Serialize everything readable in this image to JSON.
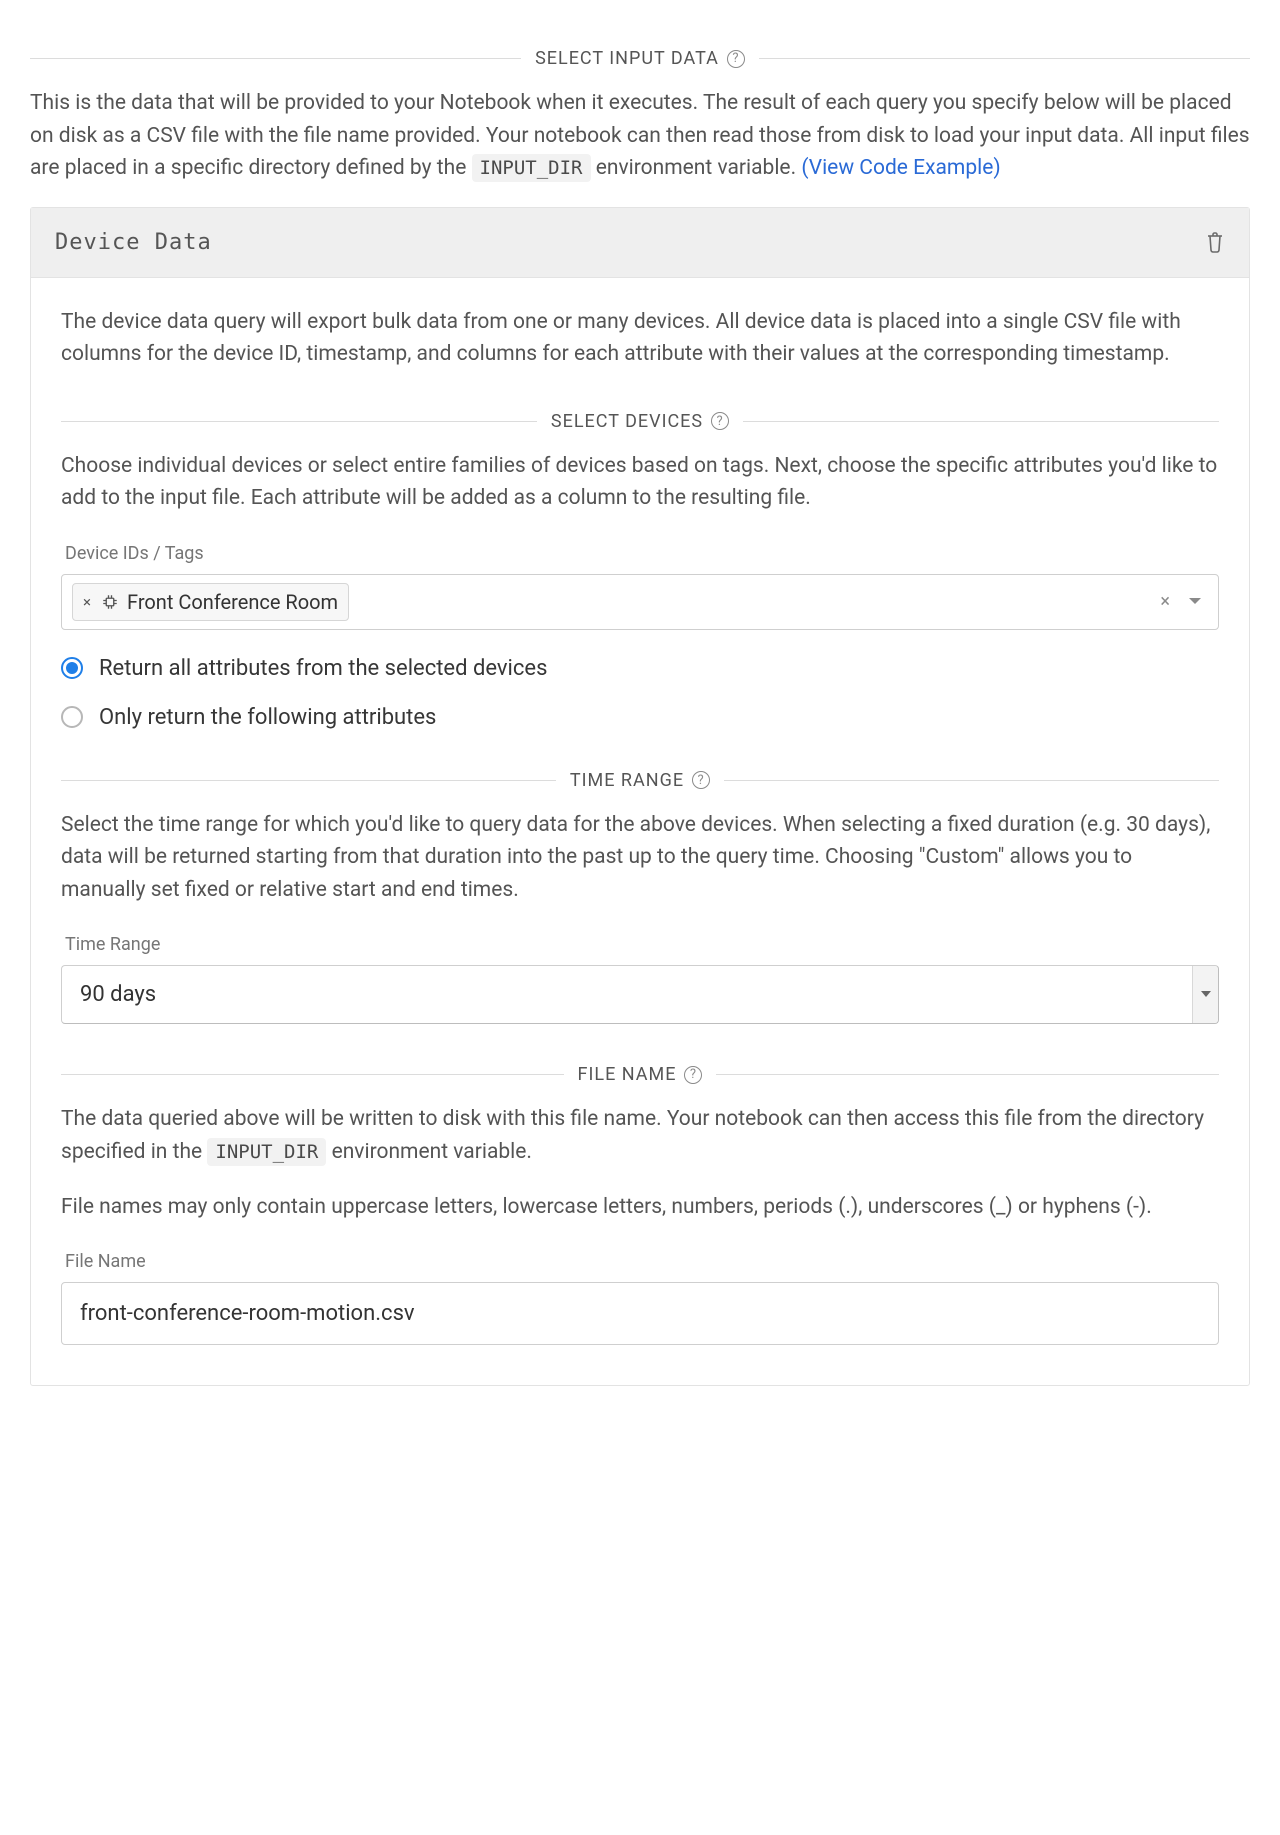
{
  "header": {
    "title": "SELECT INPUT DATA",
    "description_pre": "This is the data that will be provided to your Notebook when it executes. The result of each query you specify below will be placed on disk as a CSV file with the file name provided. Your notebook can then read those from disk to load your input data. All input files are placed in a specific directory defined by the ",
    "input_dir_code": "INPUT_DIR",
    "description_post": " environment variable. ",
    "view_example_link": "(View Code Example)"
  },
  "panel": {
    "title": "Device Data",
    "description": "The device data query will export bulk data from one or many devices. All device data is placed into a single CSV file with columns for the device ID, timestamp, and columns for each attribute with their values at the corresponding timestamp."
  },
  "devices": {
    "title": "SELECT DEVICES",
    "description": "Choose individual devices or select entire families of devices based on tags. Next, choose the specific attributes you'd like to add to the input file. Each attribute will be added as a column to the resulting file.",
    "field_label": "Device IDs / Tags",
    "selected_tag_name": "Front Conference Room",
    "radio_all": "Return all attributes from the selected devices",
    "radio_only": "Only return the following attributes",
    "radio_selected": "all"
  },
  "time_range": {
    "title": "TIME RANGE",
    "description": "Select the time range for which you'd like to query data for the above devices. When selecting a fixed duration (e.g. 30 days), data will be returned starting from that duration into the past up to the query time. Choosing \"Custom\" allows you to manually set fixed or relative start and end times.",
    "field_label": "Time Range",
    "value": "90 days"
  },
  "file_name": {
    "title": "FILE NAME",
    "description_pre": "The data queried above will be written to disk with this file name. Your notebook can then access this file from the directory specified in the ",
    "input_dir_code": "INPUT_DIR",
    "description_post": " environment variable.",
    "description2": "File names may only contain uppercase letters, lowercase letters, numbers, periods (.), underscores (_) or hyphens (-).",
    "field_label": "File Name",
    "value": "front-conference-room-motion.csv"
  }
}
